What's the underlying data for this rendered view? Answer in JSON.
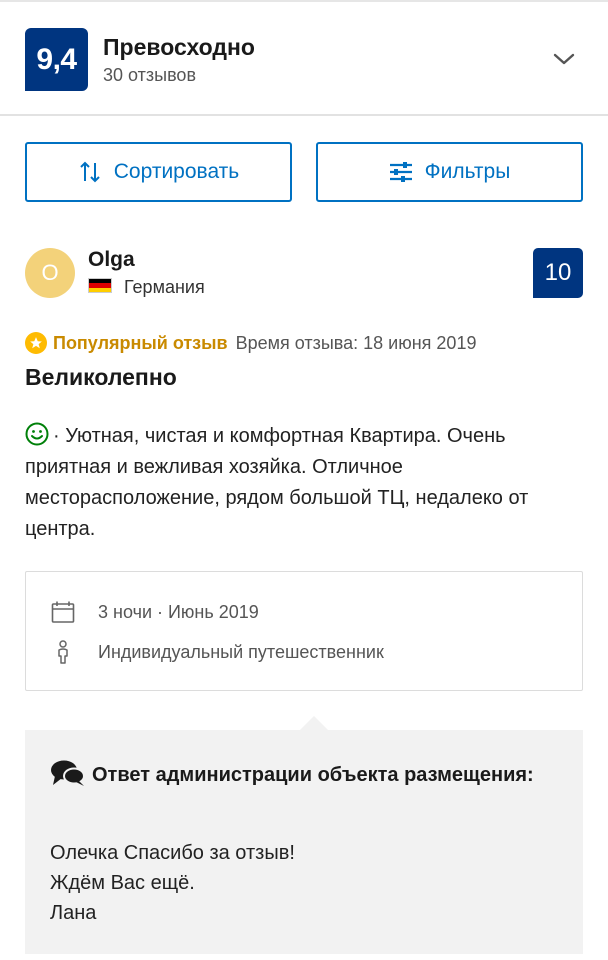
{
  "header": {
    "score": "9,4",
    "rating_word": "Превосходно",
    "review_count": "30 отзывов"
  },
  "toolbar": {
    "sort_label": "Сортировать",
    "filter_label": "Фильтры"
  },
  "review": {
    "avatar_letter": "O",
    "reviewer_name": "Olga",
    "country": "Германия",
    "score": "10",
    "popular_label": "Популярный отзыв",
    "time_label": "Время отзыва: 18 июня 2019",
    "title": "Великолепно",
    "body": "· Уютная, чистая и комфортная Квартира. Очень приятная и вежливая хозяйка. Отличное месторасположение, рядом большой ТЦ, недалеко от центра.",
    "stay_duration": "3 ночи · Июнь 2019",
    "traveler_type": "Индивидуальный путешественник"
  },
  "response": {
    "title": "Ответ администрации объекта размещения:",
    "text": "Олечка Спасибо за отзыв!\nЖдём Вас ещё.\nЛана"
  },
  "colors": {
    "brand_blue": "#003580",
    "button_blue": "#0071c2",
    "popular_gold": "#febb02",
    "avatar_yellow": "#f3d27a",
    "smile_green": "#008009"
  },
  "icons": [
    "chevron-down-icon",
    "sort-icon",
    "filter-icon",
    "star-icon",
    "smile-icon",
    "calendar-icon",
    "person-icon",
    "chat-bubbles-icon"
  ]
}
